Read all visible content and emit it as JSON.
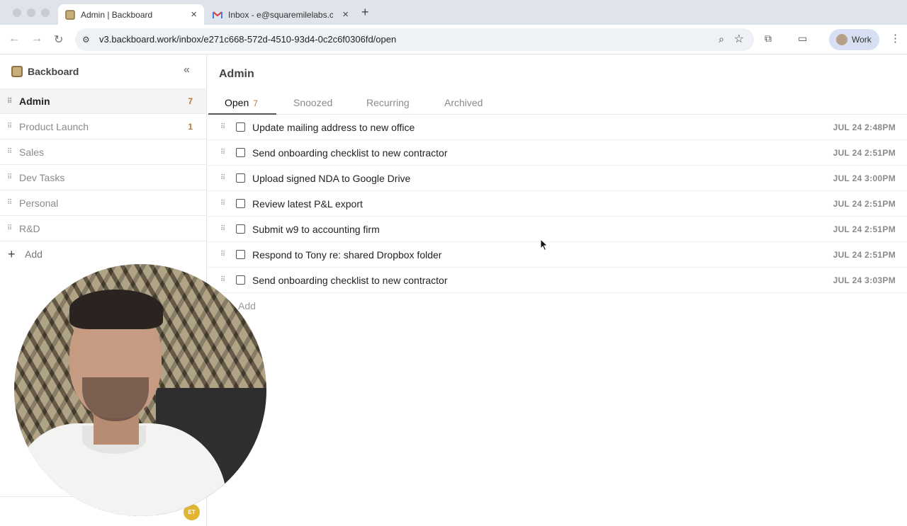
{
  "browser": {
    "tabs": [
      {
        "title": "Admin | Backboard",
        "active": true
      },
      {
        "title": "Inbox - e@squaremilelabs.co",
        "active": false
      }
    ],
    "url_host": "v3.backboard.work",
    "url_path": "/inbox/e271c668-572d-4510-93d4-0c2c6f0306fd/open",
    "profile_label": "Work"
  },
  "sidebar": {
    "brand": "Backboard",
    "items": [
      {
        "label": "Admin",
        "count": "7",
        "active": true
      },
      {
        "label": "Product Launch",
        "count": "1",
        "active": false
      },
      {
        "label": "Sales",
        "count": "",
        "active": false
      },
      {
        "label": "Dev Tasks",
        "count": "",
        "active": false
      },
      {
        "label": "Personal",
        "count": "",
        "active": false
      },
      {
        "label": "R&D",
        "count": "",
        "active": false
      }
    ],
    "add_label": "Add",
    "user_initials": "ET"
  },
  "main": {
    "title": "Admin",
    "tabs": [
      {
        "label": "Open",
        "count": "7",
        "active": true
      },
      {
        "label": "Snoozed",
        "count": "",
        "active": false
      },
      {
        "label": "Recurring",
        "count": "",
        "active": false
      },
      {
        "label": "Archived",
        "count": "",
        "active": false
      }
    ],
    "tasks": [
      {
        "title": "Update mailing address to new office",
        "time": "JUL 24 2:48PM"
      },
      {
        "title": "Send onboarding checklist to new contractor",
        "time": "JUL 24 2:51PM"
      },
      {
        "title": "Upload signed NDA to Google Drive",
        "time": "JUL 24 3:00PM"
      },
      {
        "title": "Review latest P&L export",
        "time": "JUL 24 2:51PM"
      },
      {
        "title": "Submit w9 to accounting firm",
        "time": "JUL 24 2:51PM"
      },
      {
        "title": "Respond to Tony re: shared Dropbox folder",
        "time": "JUL 24 2:51PM"
      },
      {
        "title": "Send onboarding checklist to new contractor",
        "time": "JUL 24 3:03PM"
      }
    ],
    "add_label": "Add"
  },
  "colors": {
    "accent_count": "#b5783a",
    "avatar": "#e1b635"
  },
  "icons": {
    "back": "arrow-left-icon",
    "forward": "arrow-right-icon",
    "reload": "reload-icon",
    "zoom": "zoom-icon",
    "bookmark": "star-icon",
    "extensions": "puzzle-icon",
    "collapse": "double-chevron-left-icon",
    "drag": "drag-handle-icon"
  }
}
